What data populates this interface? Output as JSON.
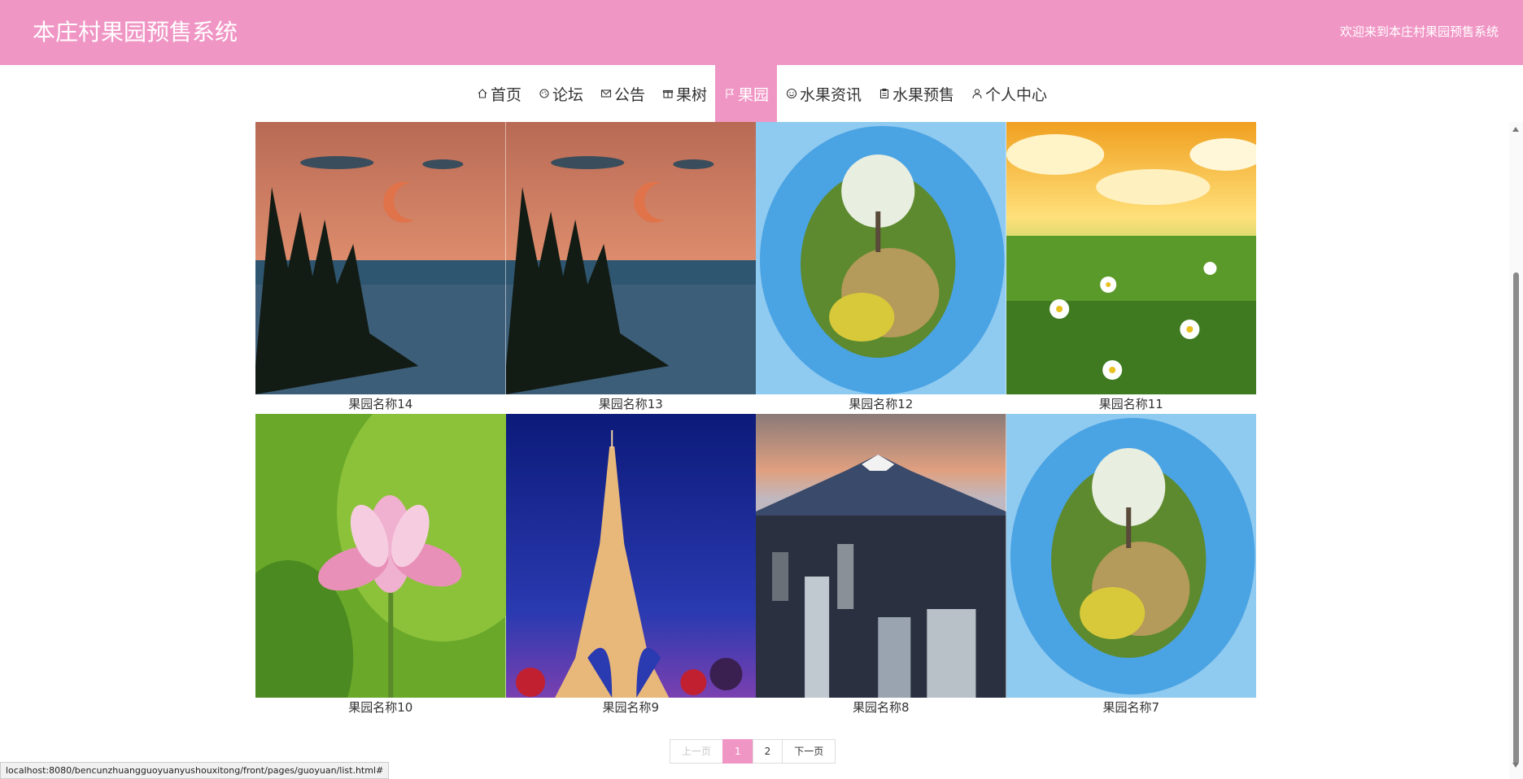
{
  "header": {
    "title": "本庄村果园预售系统",
    "welcome": "欢迎来到本庄村果园预售系统",
    "bg_color": "#f096c5"
  },
  "nav": {
    "items": [
      {
        "icon": "home-icon",
        "label": "首页"
      },
      {
        "icon": "forum-icon",
        "label": "论坛"
      },
      {
        "icon": "mail-icon",
        "label": "公告"
      },
      {
        "icon": "gift-icon",
        "label": "果树"
      },
      {
        "icon": "flag-icon",
        "label": "果园"
      },
      {
        "icon": "smile-icon",
        "label": "水果资讯"
      },
      {
        "icon": "clipboard-icon",
        "label": "水果预售"
      },
      {
        "icon": "user-icon",
        "label": "个人中心"
      }
    ],
    "active_index": 4
  },
  "orchards": [
    {
      "name": "果园名称14",
      "image": "lake-moon-sunset"
    },
    {
      "name": "果园名称13",
      "image": "lake-moon-sunset"
    },
    {
      "name": "果园名称12",
      "image": "tiny-planet-tree"
    },
    {
      "name": "果园名称11",
      "image": "daisy-field"
    },
    {
      "name": "果园名称10",
      "image": "lotus-flower"
    },
    {
      "name": "果园名称9",
      "image": "eiffel-tower-night"
    },
    {
      "name": "果园名称8",
      "image": "mount-fuji-city"
    },
    {
      "name": "果园名称7",
      "image": "tiny-planet-tree"
    }
  ],
  "pagination": {
    "prev": "上一页",
    "pages": [
      "1",
      "2"
    ],
    "current": "1",
    "next": "下一页"
  },
  "status_bar": {
    "url": "localhost:8080/bencunzhuangguoyuanyushouxitong/front/pages/guoyuan/list.html#"
  }
}
